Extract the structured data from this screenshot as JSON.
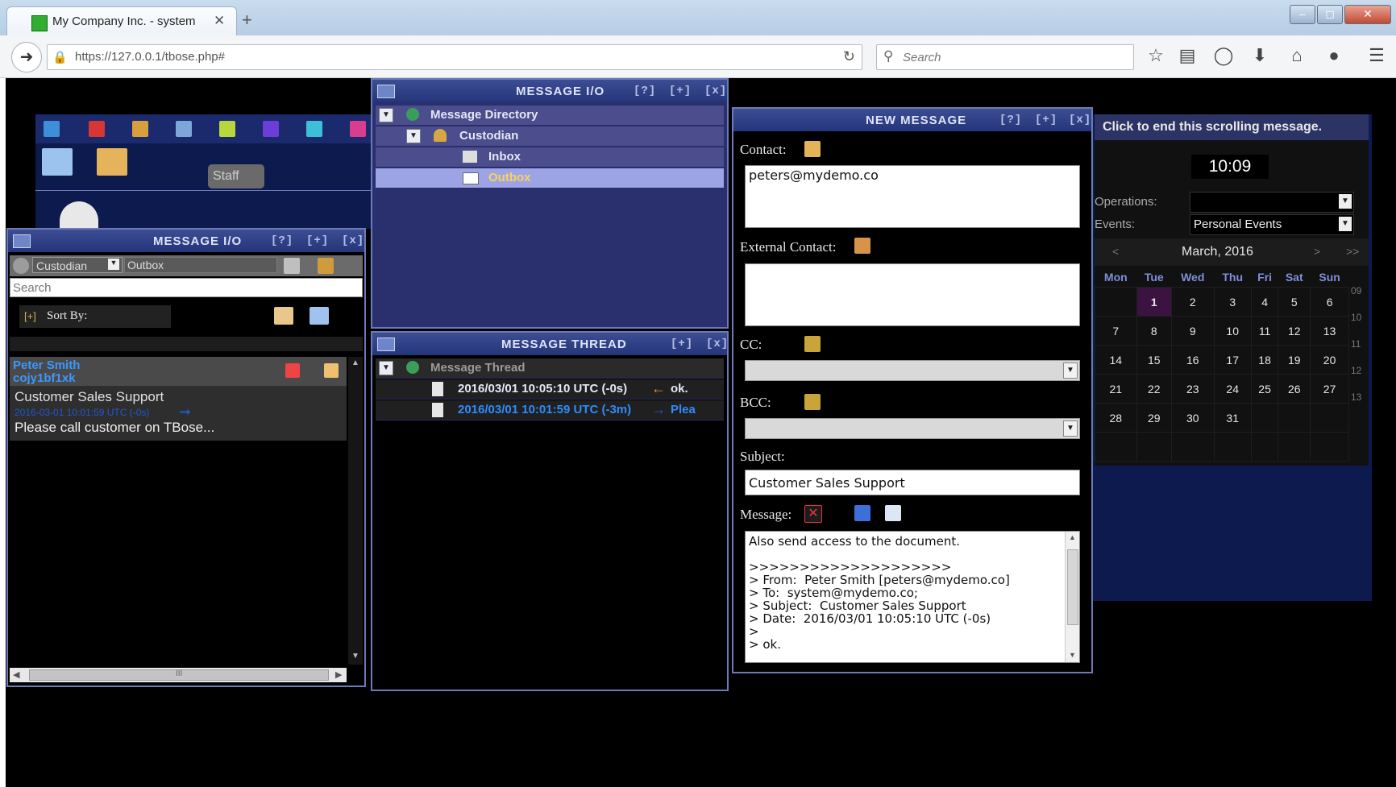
{
  "browser": {
    "tab_title": "My Company Inc. - system",
    "tab_close": "✕",
    "new_tab": "+",
    "url": "https://127.0.0.1/tbose.php#",
    "search_placeholder": "Search",
    "toolbar_icons": [
      "star-icon",
      "reading-list-icon",
      "pocket-icon",
      "download-icon",
      "home-icon",
      "chat-icon",
      "menu-icon"
    ]
  },
  "left_panel": {
    "title": "MESSAGE I/O",
    "controls": [
      "[?]",
      "[+]",
      "[x]"
    ],
    "folder_select": "Custodian",
    "folder_name": "Outbox",
    "search_placeholder": "Search",
    "sort_prefix": "[+]",
    "sort_label": "Sort By:",
    "message": {
      "sender": "Peter Smith",
      "sender_id": "cojy1bf1xk",
      "subject": "Customer Sales Support",
      "timestamp": "2016-03-01 10:01:59 UTC (-0s)",
      "preview": "Please call customer on TBose..."
    },
    "hscroll_mark": "III"
  },
  "staff_label": "Staff",
  "directory_panel": {
    "title": "MESSAGE I/O",
    "controls": [
      "[?]",
      "[+]",
      "[x]"
    ],
    "items": [
      {
        "label": "Message Directory"
      },
      {
        "label": "Custodian"
      },
      {
        "label": "Inbox"
      },
      {
        "label": "Outbox"
      }
    ]
  },
  "thread_panel": {
    "title": "MESSAGE THREAD",
    "controls": [
      "[+]",
      "[x]"
    ],
    "root": "Message Thread",
    "entries": [
      {
        "time": "2016/03/01 10:05:10 UTC (-0s)",
        "arrow": "←",
        "text": "ok.",
        "color": "#f2f2f2",
        "arrow_color": "#f08a2e"
      },
      {
        "time": "2016/03/01 10:01:59 UTC (-3m)",
        "arrow": "→",
        "text": "Plea",
        "color": "#2d8cff",
        "arrow_color": "#1a5ad8"
      }
    ]
  },
  "new_message": {
    "title": "NEW MESSAGE",
    "controls": [
      "[?]",
      "[+]",
      "[x]"
    ],
    "contact_label": "Contact:",
    "contact_value": "peters@mydemo.co",
    "external_label": "External Contact:",
    "cc_label": "CC:",
    "bcc_label": "BCC:",
    "subject_label": "Subject:",
    "subject_value": "Customer Sales Support",
    "message_label": "Message:",
    "body_lines": [
      "Also send access to the document.",
      "",
      ">>>>>>>>>>>>>>>>>>>>",
      "> From:  Peter Smith [peters@mydemo.co]",
      "> To:  system@mydemo.co;",
      "> Subject:  Customer Sales Support",
      "> Date:  2016/03/01 10:05:10 UTC (-0s)",
      ">",
      "> ok."
    ]
  },
  "right_panel": {
    "scroll_message": "Click to end this scrolling message.",
    "clock": "10:09",
    "operations_label": "Operations:",
    "operations_value": "",
    "events_label": "Events:",
    "events_value": "Personal Events",
    "calendar": {
      "month": "March, 2016",
      "prev": "<",
      "next": ">",
      "next2": ">>",
      "weekdays": [
        "Mon",
        "Tue",
        "Wed",
        "Thu",
        "Fri",
        "Sat",
        "Sun"
      ],
      "weeks": [
        {
          "num": "09",
          "days": [
            "",
            "1",
            "2",
            "3",
            "4",
            "5",
            "6"
          ]
        },
        {
          "num": "10",
          "days": [
            "7",
            "8",
            "9",
            "10",
            "11",
            "12",
            "13"
          ]
        },
        {
          "num": "11",
          "days": [
            "14",
            "15",
            "16",
            "17",
            "18",
            "19",
            "20"
          ]
        },
        {
          "num": "12",
          "days": [
            "21",
            "22",
            "23",
            "24",
            "25",
            "26",
            "27"
          ]
        },
        {
          "num": "13",
          "days": [
            "28",
            "29",
            "30",
            "31",
            "",
            "",
            ""
          ]
        },
        {
          "num": "",
          "days": [
            "",
            "",
            "",
            "",
            "",
            "",
            ""
          ]
        }
      ],
      "today": "1"
    }
  },
  "colors": {
    "panel_header": "#2f3f86",
    "tree_row": "#4b4d8c",
    "tree_selected": "#9da4e6",
    "selected_text": "#f9d25e",
    "page_bg": "#000000",
    "desktop_blue": "#0c1a4e"
  }
}
